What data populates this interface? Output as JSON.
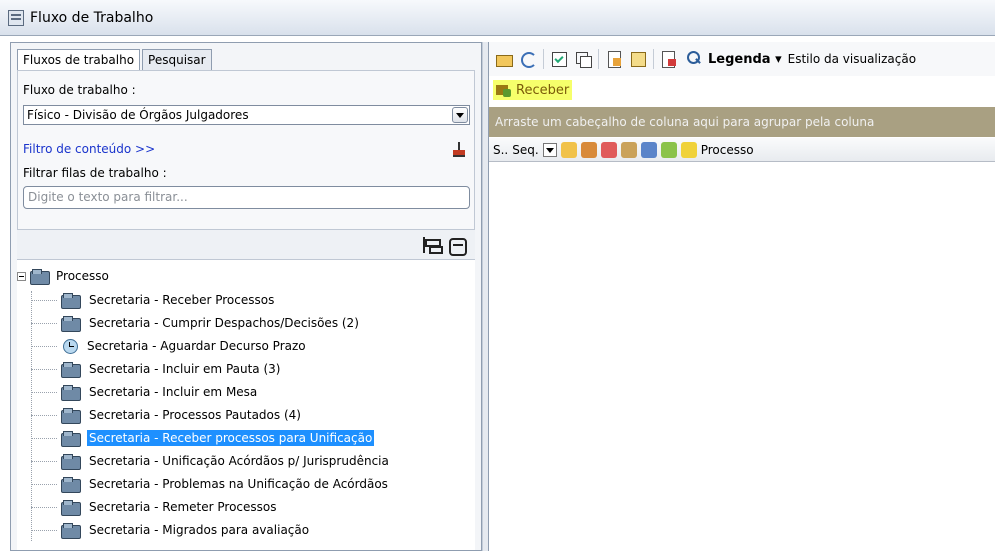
{
  "window": {
    "title": "Fluxo de Trabalho"
  },
  "left_panel": {
    "tabs": [
      {
        "label": "Fluxos de trabalho",
        "active": true
      },
      {
        "label": "Pesquisar",
        "active": false
      }
    ],
    "workflow_label": "Fluxo de trabalho :",
    "workflow_value": "Físico - Divisão de Órgãos Julgadores",
    "content_filter_link": "Filtro de conteúdo >>",
    "queue_filter_label": "Filtrar filas de trabalho :",
    "queue_filter_placeholder": "Digite o texto para filtrar...",
    "tree": {
      "root_label": "Processo",
      "items": [
        {
          "label": "Secretaria - Receber Processos",
          "icon": "folder-icon"
        },
        {
          "label": "Secretaria - Cumprir Despachos/Decisões (2)",
          "icon": "folder-icon"
        },
        {
          "label": "Secretaria - Aguardar Decurso Prazo",
          "icon": "clock-icon"
        },
        {
          "label": "Secretaria - Incluir em Pauta (3)",
          "icon": "folder-icon"
        },
        {
          "label": "Secretaria - Incluir em Mesa",
          "icon": "folder-icon"
        },
        {
          "label": "Secretaria - Processos Pautados (4)",
          "icon": "folder-icon"
        },
        {
          "label": "Secretaria - Receber processos para Unificação",
          "icon": "folder-icon",
          "selected": true
        },
        {
          "label": "Secretaria - Unificação Acórdãos p/ Jurisprudência",
          "icon": "folder-icon"
        },
        {
          "label": "Secretaria - Problemas na Unificação de Acórdãos",
          "icon": "folder-icon"
        },
        {
          "label": "Secretaria - Remeter Processos",
          "icon": "folder-icon"
        },
        {
          "label": "Secretaria - Migrados para avaliação",
          "icon": "folder-icon"
        }
      ]
    }
  },
  "right_panel": {
    "toolbar": {
      "legend_label": "Legenda",
      "view_style_label": "Estilo da visualização"
    },
    "receive_button": "Receber",
    "group_hint": "Arraste um cabeçalho de coluna aqui para agrupar pela coluna",
    "columns": {
      "status": "S..",
      "seq": "Seq.",
      "process": "Processo"
    }
  },
  "colors": {
    "selection": "#1e90ff",
    "receive_highlight": "#f6ff6b",
    "group_bar": "#a9a082",
    "link": "#1a34cc"
  }
}
